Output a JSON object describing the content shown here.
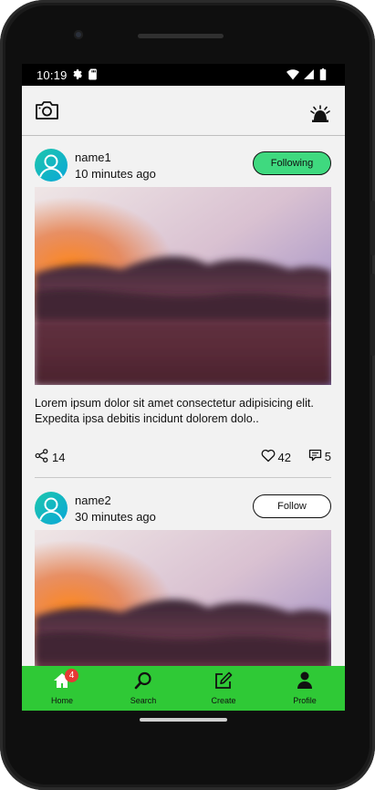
{
  "status_bar": {
    "time": "10:19"
  },
  "top_bar": {
    "camera_icon": "camera-icon",
    "notification_icon": "alarm-bell-icon"
  },
  "posts": [
    {
      "name": "name1",
      "time": "10 minutes ago",
      "follow_label": "Following",
      "text": "Lorem ipsum dolor sit amet consectetur adipisicing elit. Expedita ipsa debitis incidunt dolorem dolo..",
      "shares": "14",
      "likes": "42",
      "comments": "5"
    },
    {
      "name": "name2",
      "time": "30 minutes ago",
      "follow_label": "Follow"
    }
  ],
  "nav": {
    "items": [
      {
        "label": "Home",
        "icon": "home-icon",
        "badge": "4"
      },
      {
        "label": "Search",
        "icon": "search-icon"
      },
      {
        "label": "Create",
        "icon": "edit-icon"
      },
      {
        "label": "Profile",
        "icon": "person-icon"
      }
    ]
  },
  "colors": {
    "nav_bg": "#2fc936",
    "following_bg": "#3fd97f",
    "badge": "#e53935",
    "app_bg": "#f2f2f2"
  }
}
